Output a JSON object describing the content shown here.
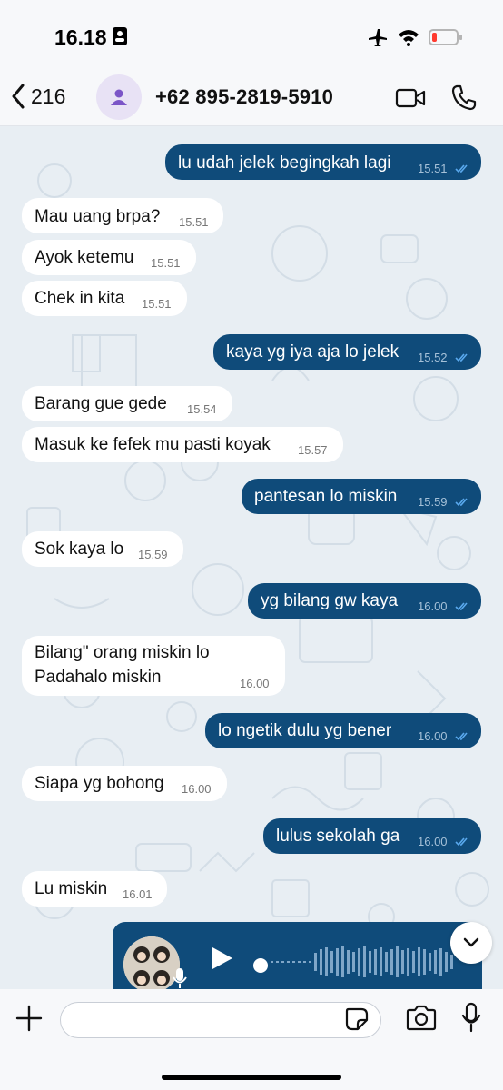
{
  "status_bar": {
    "time": "16.18"
  },
  "header": {
    "back_count": "216",
    "contact": "+62 895-2819-5910"
  },
  "messages": [
    {
      "dir": "out",
      "text": "lu udah jelek begingkah lagi",
      "time": "15.51"
    },
    {
      "dir": "in",
      "text": "Mau uang brpa?",
      "time": "15.51"
    },
    {
      "dir": "in",
      "text": "Ayok ketemu",
      "time": "15.51"
    },
    {
      "dir": "in",
      "text": "Chek in kita",
      "time": "15.51"
    },
    {
      "dir": "out",
      "text": "kaya yg iya aja lo jelek",
      "time": "15.52"
    },
    {
      "dir": "in",
      "text": "Barang gue gede",
      "time": "15.54"
    },
    {
      "dir": "in",
      "text": "Masuk ke fefek mu pasti koyak",
      "time": "15.57"
    },
    {
      "dir": "out",
      "text": "pantesan lo miskin",
      "time": "15.59"
    },
    {
      "dir": "in",
      "text": "Sok kaya lo",
      "time": "15.59"
    },
    {
      "dir": "out",
      "text": "yg bilang gw kaya",
      "time": "16.00"
    },
    {
      "dir": "in",
      "text": "Bilang\" orang miskin lo",
      "text2": "Padahalo miskin",
      "time": "16.00"
    },
    {
      "dir": "out",
      "text": "lo ngetik dulu yg bener",
      "time": "16.00"
    },
    {
      "dir": "in",
      "text": "Siapa yg bohong",
      "time": "16.00"
    },
    {
      "dir": "out",
      "text": "lulus sekolah ga",
      "time": "16.00"
    },
    {
      "dir": "in",
      "text": "Lu miskin",
      "time": "16.01"
    }
  ],
  "colors": {
    "outgoing": "#0f4b7a",
    "incoming": "#ffffff",
    "ticks": "#5aa9ee"
  }
}
